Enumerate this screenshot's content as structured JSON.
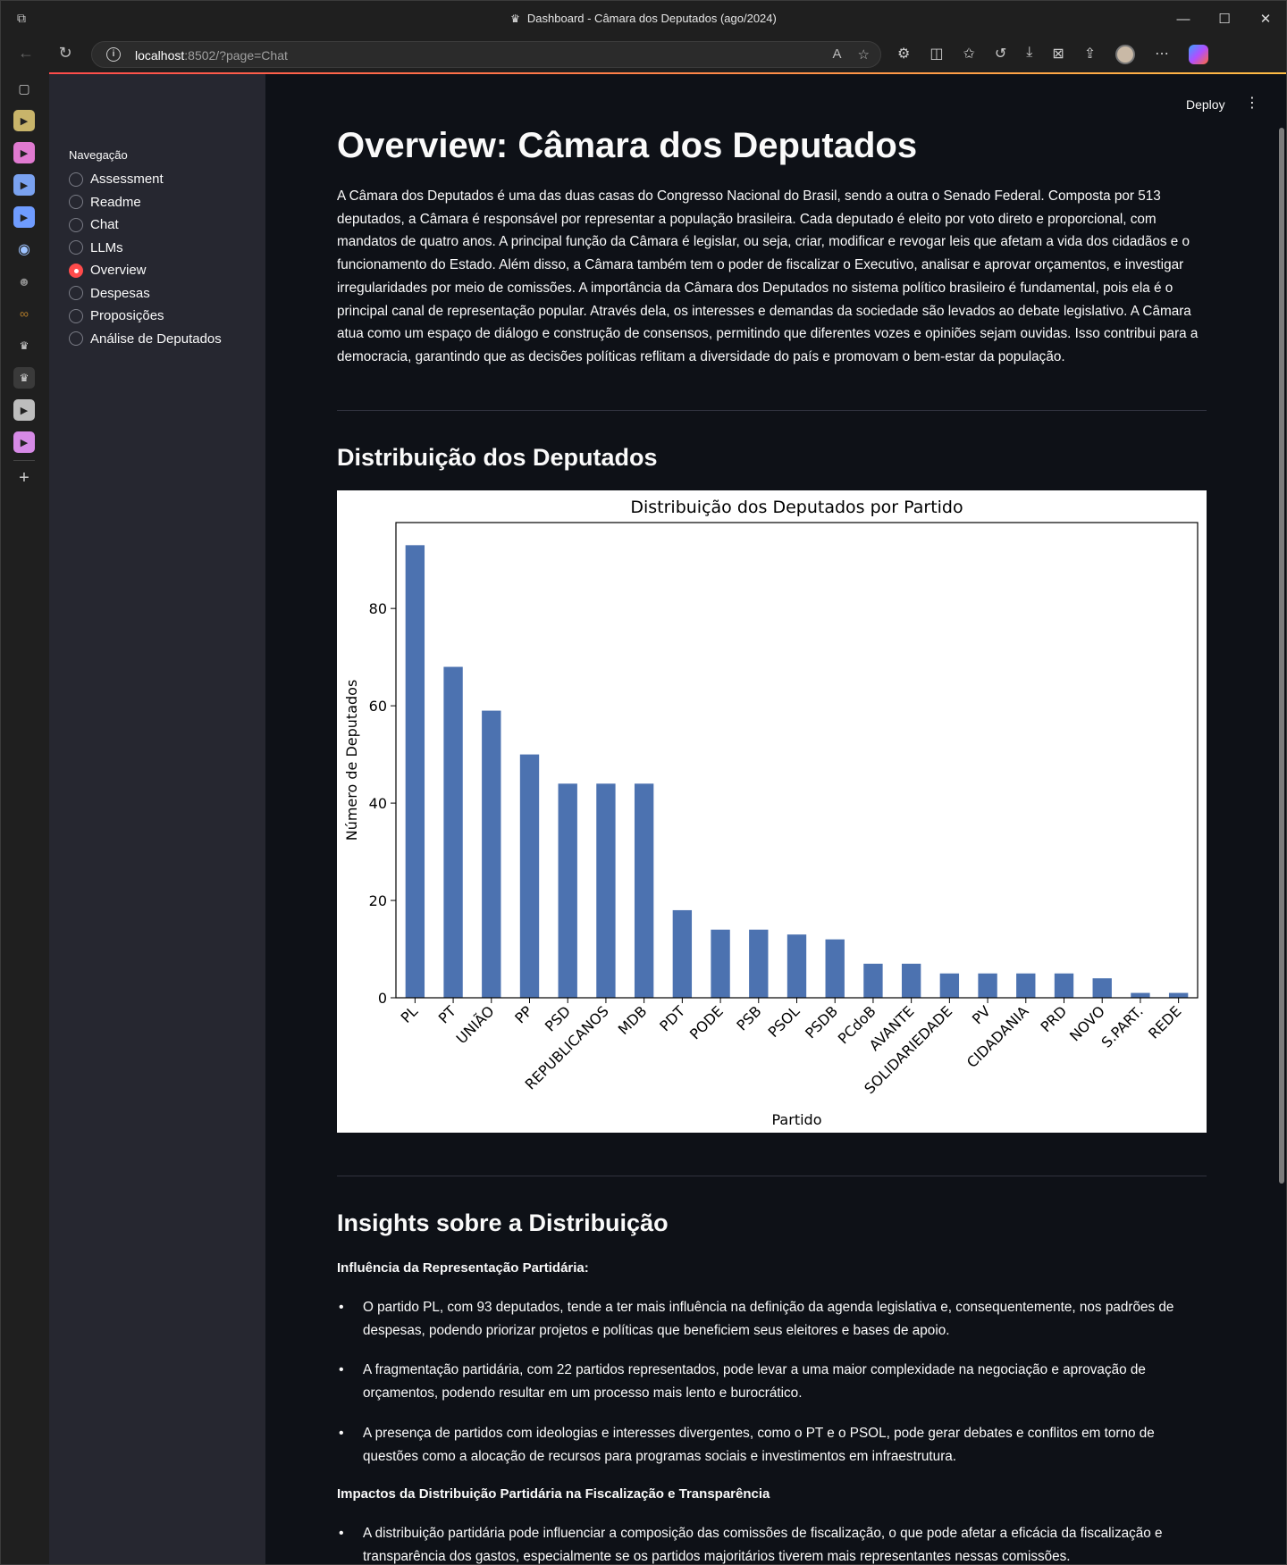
{
  "browser": {
    "window_title": "Dashboard - Câmara dos Deputados (ago/2024)",
    "url_host": "localhost",
    "url_rest": ":8502/?page=Chat"
  },
  "sidebar": {
    "nav_label": "Navegação",
    "items": [
      {
        "label": "Assessment",
        "selected": false
      },
      {
        "label": "Readme",
        "selected": false
      },
      {
        "label": "Chat",
        "selected": false
      },
      {
        "label": "LLMs",
        "selected": false
      },
      {
        "label": "Overview",
        "selected": true
      },
      {
        "label": "Despesas",
        "selected": false
      },
      {
        "label": "Proposições",
        "selected": false
      },
      {
        "label": "Análise de Deputados",
        "selected": false
      }
    ]
  },
  "header": {
    "deploy_label": "Deploy"
  },
  "main": {
    "title": "Overview: Câmara dos Deputados",
    "intro": "A Câmara dos Deputados é uma das duas casas do Congresso Nacional do Brasil, sendo a outra o Senado Federal. Composta por 513 deputados, a Câmara é responsável por representar a população brasileira. Cada deputado é eleito por voto direto e proporcional, com mandatos de quatro anos. A principal função da Câmara é legislar, ou seja, criar, modificar e revogar leis que afetam a vida dos cidadãos e o funcionamento do Estado. Além disso, a Câmara também tem o poder de fiscalizar o Executivo, analisar e aprovar orçamentos, e investigar irregularidades por meio de comissões. A importância da Câmara dos Deputados no sistema político brasileiro é fundamental, pois ela é o principal canal de representação popular. Através dela, os interesses e demandas da sociedade são levados ao debate legislativo. A Câmara atua como um espaço de diálogo e construção de consensos, permitindo que diferentes vozes e opiniões sejam ouvidas. Isso contribui para a democracia, garantindo que as decisões políticas reflitam a diversidade do país e promovam o bem-estar da população.",
    "section_distribution": "Distribuição dos Deputados",
    "section_insights": "Insights sobre a Distribuição",
    "insights_heading_1": "Influência da Representação Partidária:",
    "insights_bullets_1": [
      "O partido PL, com 93 deputados, tende a ter mais influência na definição da agenda legislativa e, consequentemente, nos padrões de despesas, podendo priorizar projetos e políticas que beneficiem seus eleitores e bases de apoio.",
      "A fragmentação partidária, com 22 partidos representados, pode levar a uma maior complexidade na negociação e aprovação de orçamentos, podendo resultar em um processo mais lento e burocrático.",
      "A presença de partidos com ideologias e interesses divergentes, como o PT e o PSOL, pode gerar debates e conflitos em torno de questões como a alocação de recursos para programas sociais e investimentos em infraestrutura."
    ],
    "insights_heading_2": "Impactos da Distribuição Partidária na Fiscalização e Transparência",
    "insights_bullets_2": [
      "A distribuição partidária pode influenciar a composição das comissões de fiscalização, o que pode afetar a eficácia da fiscalização e transparência dos gastos, especialmente se os partidos majoritários tiverem mais representantes nessas comissões."
    ]
  },
  "chart_data": {
    "type": "bar",
    "title": "Distribuição dos Deputados por Partido",
    "xlabel": "Partido",
    "ylabel": "Número de Deputados",
    "categories": [
      "PL",
      "PT",
      "UNIÃO",
      "PP",
      "PSD",
      "REPUBLICANOS",
      "MDB",
      "PDT",
      "PODE",
      "PSB",
      "PSOL",
      "PSDB",
      "PCdoB",
      "AVANTE",
      "SOLIDARIEDADE",
      "PV",
      "CIDADANIA",
      "PRD",
      "NOVO",
      "S.PART.",
      "REDE"
    ],
    "values": [
      93,
      68,
      59,
      50,
      44,
      44,
      44,
      18,
      14,
      14,
      13,
      12,
      7,
      7,
      5,
      5,
      5,
      5,
      4,
      1,
      1
    ],
    "yticks": [
      0,
      20,
      40,
      60,
      80
    ],
    "ylim": [
      0,
      97.65
    ],
    "bar_color": "#4c72b0",
    "grid": false,
    "legend": "none"
  }
}
